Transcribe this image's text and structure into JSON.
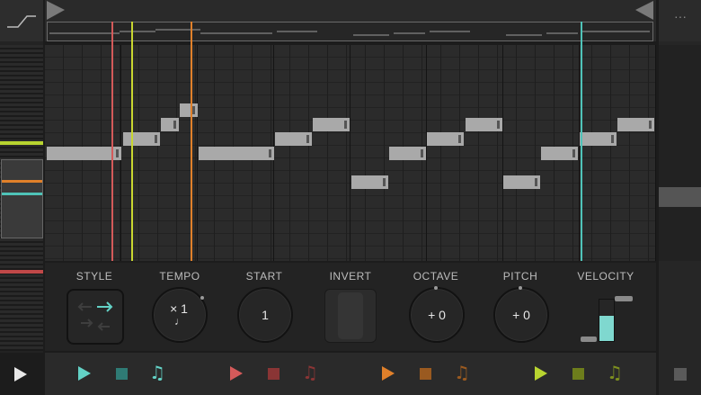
{
  "controls": {
    "style_label": "STYLE",
    "tempo_label": "TEMPO",
    "tempo_value": "× 1",
    "tempo_note_icon": "♩",
    "start_label": "START",
    "start_value": "1",
    "invert_label": "INVERT",
    "octave_label": "OCTAVE",
    "octave_value": "+ 0",
    "pitch_label": "PITCH",
    "pitch_value": "+ 0",
    "velocity_label": "VELOCITY",
    "velocity_level": 0.6
  },
  "icons": {
    "transport_play": "play-icon",
    "transport_stop": "stop-icon",
    "note": "♫",
    "menu": "···"
  },
  "tracks": [
    {
      "color": "#4fc3b8",
      "note_color": "#63d2c6"
    },
    {
      "color": "#d45a5a",
      "note_color": "#8a3535"
    },
    {
      "color": "#e0802a",
      "note_color": "#9a5a20"
    },
    {
      "color": "#b8d430",
      "note_color": "#7d8f1f"
    }
  ],
  "colors": {
    "playhead_red": "#d45a5a",
    "playhead_yellow": "#c8d630",
    "playhead_orange": "#e0802a",
    "playhead_teal": "#4fc3b8",
    "velocity": "#7fd8cf"
  }
}
